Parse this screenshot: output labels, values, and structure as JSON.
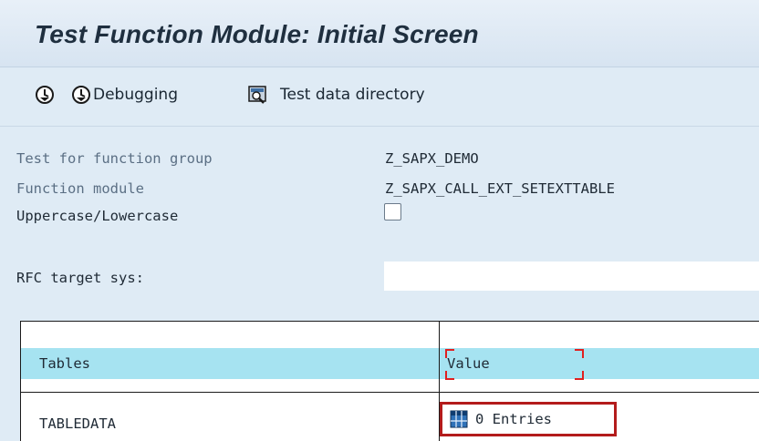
{
  "window": {
    "title": "Test Function Module: Initial Screen"
  },
  "toolbar": {
    "execute_icon": "execute-icon",
    "debugging_label": "Debugging",
    "test_data_label": "Test data directory"
  },
  "form": {
    "function_group_label": "Test for function group",
    "function_group_value": "Z_SAPX_DEMO",
    "function_module_label": "Function module",
    "function_module_value": "Z_SAPX_CALL_EXT_SETEXTTABLE",
    "case_label": "Uppercase/Lowercase",
    "case_checked": false,
    "rfc_label": "RFC target sys:",
    "rfc_value": ""
  },
  "table": {
    "headers": [
      "Tables",
      "Value"
    ],
    "rows": [
      {
        "name": "TABLEDATA",
        "value": "0 Entries"
      }
    ]
  },
  "colors": {
    "header_bg": "#a6e3f1",
    "highlight_border": "#b31b1b",
    "focus_marker": "#e02020"
  }
}
